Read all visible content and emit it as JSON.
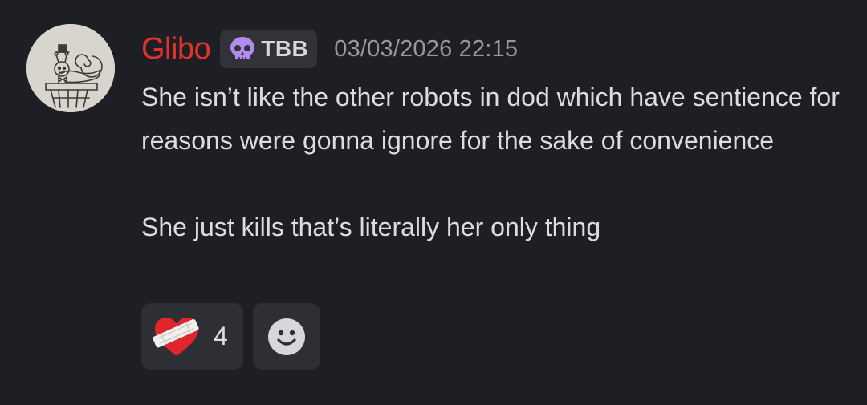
{
  "message": {
    "author": {
      "name": "Glibo",
      "name_color": "#e0322e",
      "avatar_icon": "sketch-snail-avatar"
    },
    "tag": {
      "icon": "purple-skull-icon",
      "label": "TBB"
    },
    "timestamp": "03/03/2026 22:15",
    "paragraphs": [
      "She isn’t like the other robots in dod which have sentience for reasons were gonna ignore for the sake of convenience",
      "She just kills that’s literally her only thing"
    ]
  },
  "reactions": [
    {
      "emoji": "mending-heart-icon",
      "count": "4"
    }
  ],
  "add_reaction": {
    "icon": "smiley-face-icon"
  },
  "colors": {
    "background": "#1e1f24",
    "text": "#dcdde1",
    "timestamp": "#96989e",
    "pill": "#2d2f35"
  }
}
